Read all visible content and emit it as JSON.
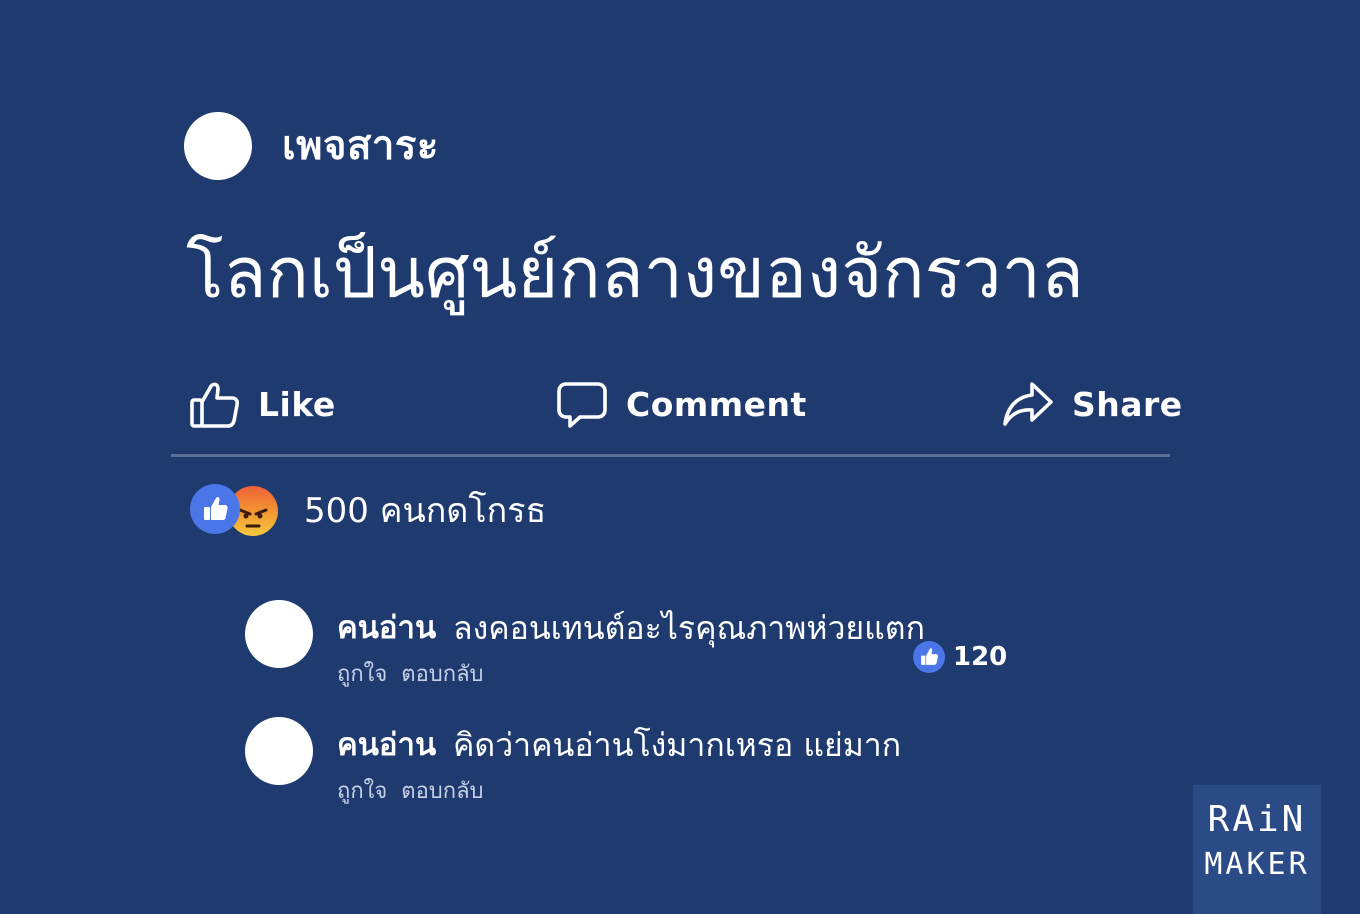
{
  "post": {
    "page_name": "เพจสาระ",
    "text": "โลกเป็นศูนย์กลางของจักรวาล"
  },
  "actions": {
    "like": "Like",
    "comment": "Comment",
    "share": "Share"
  },
  "reactions": {
    "summary": "500 คนกดโกรธ",
    "icons": [
      "like-icon",
      "angry-icon"
    ]
  },
  "comments": [
    {
      "author": "คนอ่าน",
      "text": "ลงคอนเทนต์อะไรคุณภาพห่วยแตก",
      "like_link": "ถูกใจ",
      "reply_link": "ตอบกลับ",
      "likes": "120"
    },
    {
      "author": "คนอ่าน",
      "text": "คิดว่าคนอ่านโง่มากเหรอ แย่มาก",
      "like_link": "ถูกใจ",
      "reply_link": "ตอบกลับ"
    }
  ],
  "brand": {
    "line1": "RAiN",
    "line2": "MAKER"
  },
  "colors": {
    "background": "#1e3a6e",
    "like_blue": "#4a76e8",
    "divider": "#5a6f99"
  }
}
